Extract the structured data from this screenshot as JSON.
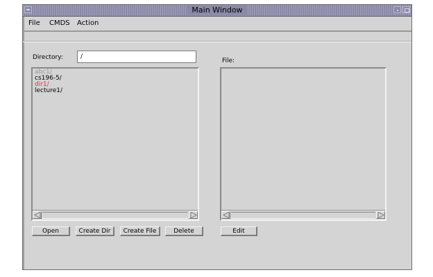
{
  "window": {
    "title": "Main Window"
  },
  "menubar": {
    "items": [
      "File",
      "CMDS",
      "Action"
    ]
  },
  "directory": {
    "label": "Directory:",
    "value": "/"
  },
  "file": {
    "label": "File:"
  },
  "directory_list": {
    "items": [
      {
        "text": "abc1/",
        "color": "#9a9a9a"
      },
      {
        "text": "cs196-5/",
        "color": "#000000"
      },
      {
        "text": "dir1/",
        "color": "#e0303a"
      },
      {
        "text": "lecture1/",
        "color": "#000000"
      }
    ]
  },
  "buttons": {
    "open": "Open",
    "create_dir": "Create Dir",
    "create_file": "Create File",
    "delete": "Delete",
    "edit": "Edit"
  }
}
